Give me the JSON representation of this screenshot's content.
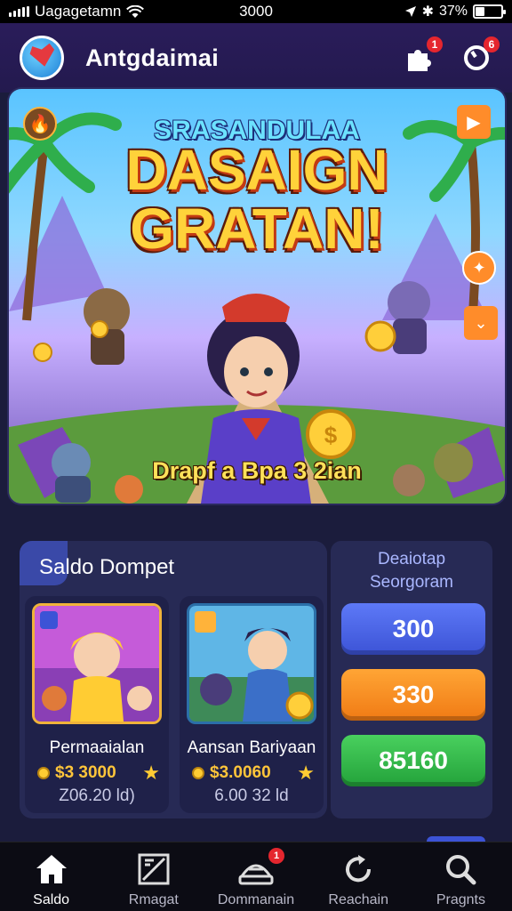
{
  "status_bar": {
    "carrier": "Uagagetamn",
    "time": "3000",
    "battery": "37%"
  },
  "header": {
    "title": "Antgdaimai",
    "logo_icon": "heart-globe-logo",
    "notifications_badge": "1",
    "profile_badge": "6"
  },
  "hero": {
    "subtitle": "SRASANDULAA",
    "title_line1": "DASAIGN",
    "title_line2": "GRATAN!",
    "caption": "Drapf a Bpa 3 2ian"
  },
  "wallet": {
    "title": "Saldo Dompet",
    "cards": [
      {
        "name": "Permaaialan",
        "price": "$3 3000",
        "sub": "Z06.20 ld)"
      },
      {
        "name": "Aansan Bariyaan",
        "price": "$3.0060",
        "sub": "6.00 32 ld"
      }
    ]
  },
  "side_panel": {
    "title_line1": "Deaiotap",
    "title_line2": "Seorgoram",
    "amounts": [
      "300",
      "330",
      "85160"
    ]
  },
  "nav": {
    "items": [
      {
        "label": "Saldo",
        "icon": "home-icon",
        "active": true
      },
      {
        "label": "Rmagat",
        "icon": "picture-icon",
        "active": false
      },
      {
        "label": "Dommanain",
        "icon": "hat-icon",
        "active": false,
        "badge": "1"
      },
      {
        "label": "Reachain",
        "icon": "refresh-icon",
        "active": false
      },
      {
        "label": "Pragnts",
        "icon": "search-icon",
        "active": false
      }
    ]
  },
  "colors": {
    "background": "#1b1c3c",
    "accent_blue": "#3c53d6",
    "accent_orange": "#f07a14",
    "accent_green": "#23a23a",
    "badge_red": "#e5262e",
    "gold": "#ffc53a"
  }
}
